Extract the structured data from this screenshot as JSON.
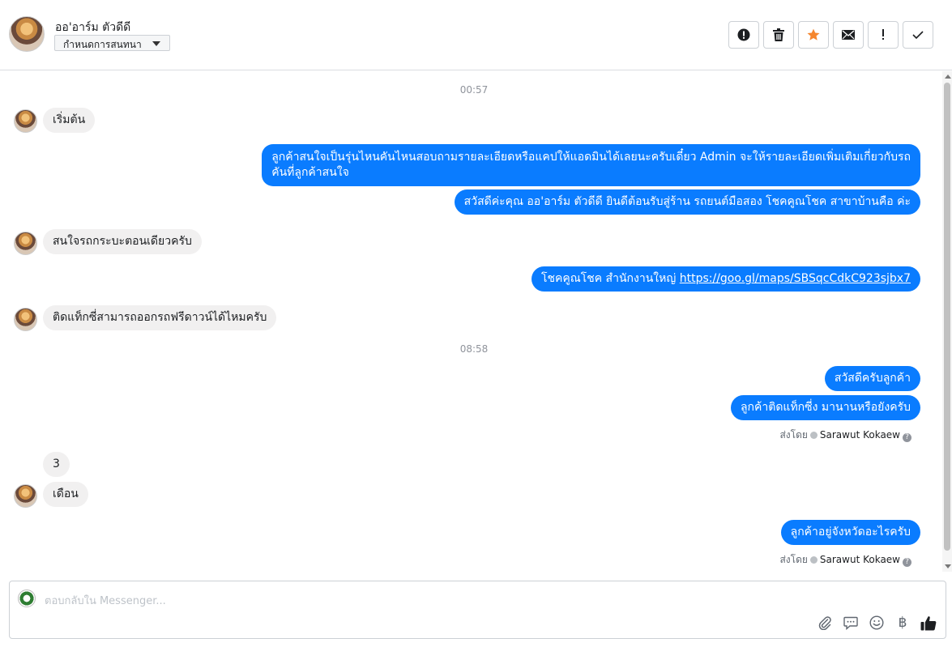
{
  "header": {
    "contact_name": "ออ'อาร์ม ตัวดีดี",
    "stage_label": "กำหนดการสนทนา",
    "actions": [
      {
        "name": "spam-icon"
      },
      {
        "name": "trash-icon"
      },
      {
        "name": "star-icon",
        "color": "#f5862e"
      },
      {
        "name": "mail-icon"
      },
      {
        "name": "follow-up-icon"
      },
      {
        "name": "check-icon"
      }
    ]
  },
  "conversation": {
    "timestamps": [
      "00:57",
      "08:58"
    ],
    "messages": [
      {
        "dir": "in",
        "text": "เริ่มต้น"
      },
      {
        "dir": "out",
        "line1": "ลูกค้าสนใจเป็นรุ่นไหนคันไหนสอบถามรายละเอียดหรือแคปให้แอดมินได้เลยนะครับเดี๋ยว Admin จะให้รายละเอียดเพิ่มเติมเกี่ยวกับรถ",
        "line2": "คันที่ลูกค้าสนใจ"
      },
      {
        "dir": "out",
        "text": "สวัสดีค่ะคุณ ออ'อาร์ม ตัวดีดี ยินดีต้อนรับสู่ร้าน รถยนต์มือสอง โชคคูณโชค สาขาบ้านคือ ค่ะ"
      },
      {
        "dir": "in",
        "text": "สนใจรถกระบะตอนเดียวครับ"
      },
      {
        "dir": "out",
        "text": "โชคคูณโชค สำนักงานใหญ่",
        "link": "https://goo.gl/maps/SBSqcCdkC923sjbx7"
      },
      {
        "dir": "in",
        "text": "ติดแท็กซี่สามารถออกรถฟรีดาวน์ได้ไหมครับ"
      },
      {
        "dir": "out",
        "text": "สวัสดีครับลูกค้า"
      },
      {
        "dir": "out",
        "text": "ลูกค้าติดแท็กซี่ง มานานหรือยังครับ"
      },
      {
        "dir": "in",
        "text": "3"
      },
      {
        "dir": "in",
        "text": "เดือน"
      },
      {
        "dir": "out",
        "text": "ลูกค้าอยู่จังหวัดอะไรครับ"
      }
    ],
    "sent_by_label": "ส่งโดย",
    "sender": "Sarawut Kokaew",
    "help_glyph": "?"
  },
  "composer": {
    "placeholder": "ตอบกลับใน Messenger...",
    "tools": [
      "attachment-icon",
      "saved-replies-icon",
      "emoji-icon",
      "baht-icon",
      "like-icon"
    ],
    "baht_glyph": "฿"
  }
}
